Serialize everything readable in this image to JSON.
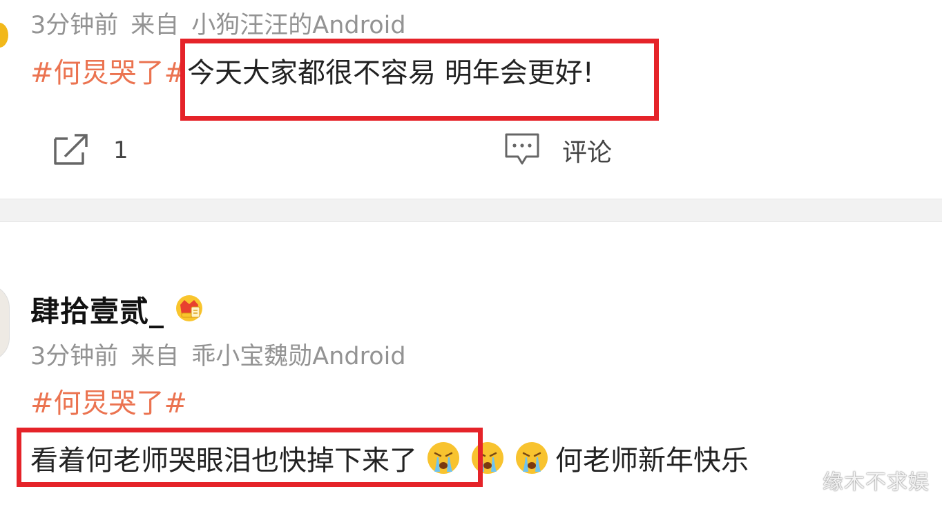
{
  "posts": [
    {
      "meta": {
        "time": "3分钟前",
        "source_prefix": "来自",
        "source": "小狗汪汪的Android"
      },
      "hashtag": "#何炅哭了#",
      "text": "今天大家都很不容易 明年会更好!",
      "actions": {
        "share_count": "1",
        "comment_label": "评论"
      }
    },
    {
      "username": "肆拾壹贰_",
      "meta": {
        "time": "3分钟前",
        "source_prefix": "来自",
        "source": "乖小宝魏勋Android"
      },
      "hashtag": "#何炅哭了#",
      "text": "看着何老师哭眼泪也快掉下来了",
      "text_after_emoji": "何老师新年快乐"
    }
  ],
  "icons": {
    "share": "share-icon",
    "comment": "comment-icon",
    "badge": "crown-badge-icon",
    "emoji": "crying-face-emoji"
  },
  "colors": {
    "hashtag": "#eb7350",
    "highlight_border": "#e52329",
    "meta_text": "#939393",
    "divider": "#f2f2f2"
  },
  "watermark": "缘木不求娱"
}
